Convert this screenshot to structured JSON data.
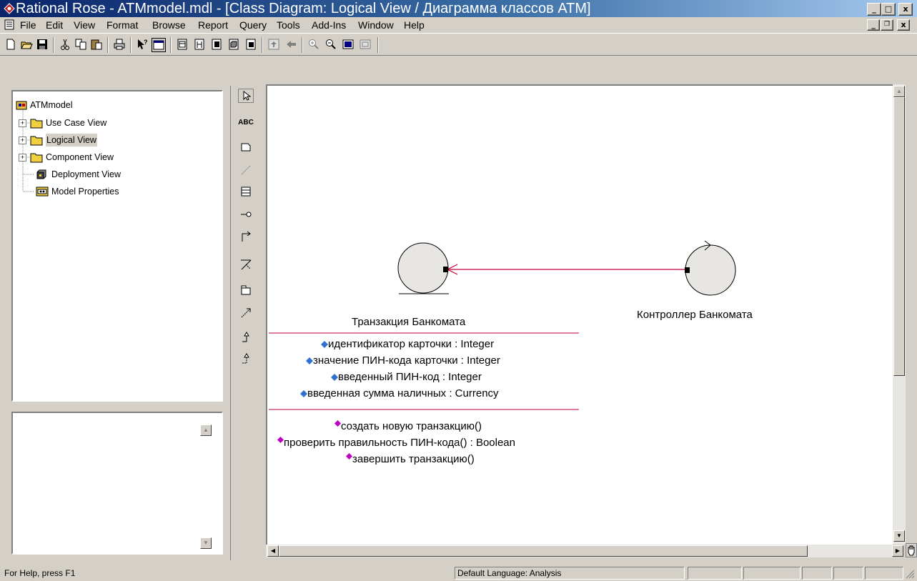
{
  "window": {
    "title": "Rational Rose - ATMmodel.mdl - [Class Diagram: Logical View / Диаграмма классов ATM]",
    "minimize": "_",
    "maximize": "□",
    "close": "x"
  },
  "menu": {
    "items": [
      "File",
      "Edit",
      "View",
      "Format",
      "Browse",
      "Report",
      "Query",
      "Tools",
      "Add-Ins",
      "Window",
      "Help"
    ]
  },
  "toolbar": {
    "icons": [
      "new-icon",
      "open-icon",
      "save-icon",
      "cut-icon",
      "copy-icon",
      "paste-icon",
      "print-icon",
      "context-help-icon",
      "view-documentation-icon",
      "browse-class-diagram-icon",
      "browse-interaction-diagram-icon",
      "browse-component-diagram-icon",
      "browse-deployment-diagram-icon",
      "browse-parent-icon",
      "browse-previous-diagram-icon",
      "previous-diagram-icon",
      "zoom-in-icon",
      "zoom-out-icon",
      "fit-in-window-icon",
      "undo-fit-icon"
    ]
  },
  "browser": {
    "root": "ATMmodel",
    "items": [
      {
        "label": "Use Case View",
        "icon": "folder-icon"
      },
      {
        "label": "Logical View",
        "icon": "folder-icon"
      },
      {
        "label": "Component View",
        "icon": "folder-icon"
      },
      {
        "label": "Deployment View",
        "icon": "deployment-icon"
      },
      {
        "label": "Model Properties",
        "icon": "properties-icon"
      }
    ]
  },
  "toolbox": {
    "tools": [
      "selection-tool-icon",
      "text-tool-icon",
      "note-tool-icon",
      "anchor-note-icon",
      "class-tool-icon",
      "interface-tool-icon",
      "unidirectional-association-icon",
      "association-class-icon",
      "package-tool-icon",
      "dependency-tool-icon",
      "generalization-tool-icon",
      "realization-tool-icon"
    ],
    "text_tool_label": "ABC"
  },
  "diagram": {
    "class_left": {
      "name": "Транзакция Банкомата",
      "attributes": [
        "идентификатор карточки : Integer",
        "значение ПИН-кода карточки : Integer",
        "введенный ПИН-код : Integer",
        "введенная сумма наличных : Currency"
      ],
      "operations": [
        "создать новую транзакцию()",
        "проверить правильность ПИН-кода() : Boolean",
        "завершить транзакцию()"
      ],
      "stereotype_icon": "entity-icon"
    },
    "class_right": {
      "name": "Контроллер Банкомата",
      "stereotype_icon": "control-icon"
    },
    "colors": {
      "association": "#c0003a",
      "compartment_line": "#c0003a",
      "class_fill": "#e8e6e2",
      "attribute_icon": "#3070d0",
      "operation_icon": "#c000c0"
    }
  },
  "statusbar": {
    "help": "For Help, press F1",
    "language": "Default Language: Analysis"
  }
}
